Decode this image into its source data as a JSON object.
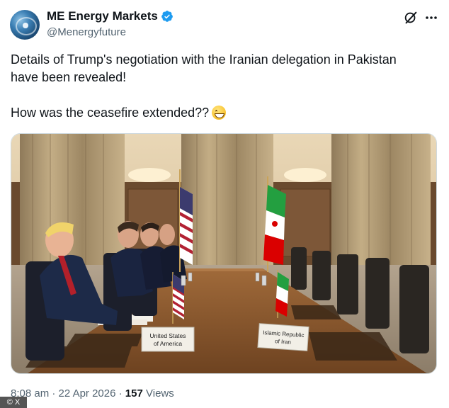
{
  "author": {
    "name": "ME Energy Markets",
    "handle": "@Menergyfuture",
    "avatar_icon": "avatar-image",
    "verified_color": "#1d9bf0"
  },
  "tweet": {
    "line1": "Details of Trump's negotiation with the Iranian delegation in Pakistan",
    "line2": "have been revealed!",
    "line3": "How was the ceasefire extended??",
    "emoji": "grinning-face-emoji"
  },
  "media": {
    "placard_usa_line1": "United States",
    "placard_usa_line2": "of America",
    "placard_iran_line1": "Islamic Republic",
    "placard_iran_line2": "of Iran"
  },
  "meta": {
    "time": "8:08 am",
    "separator": "·",
    "date": "22 Apr 2026",
    "views_count": "157",
    "views_label": "Views"
  },
  "corner_badge": "© X",
  "icons": {
    "grok": "grok-icon",
    "more": "more-options-icon"
  }
}
